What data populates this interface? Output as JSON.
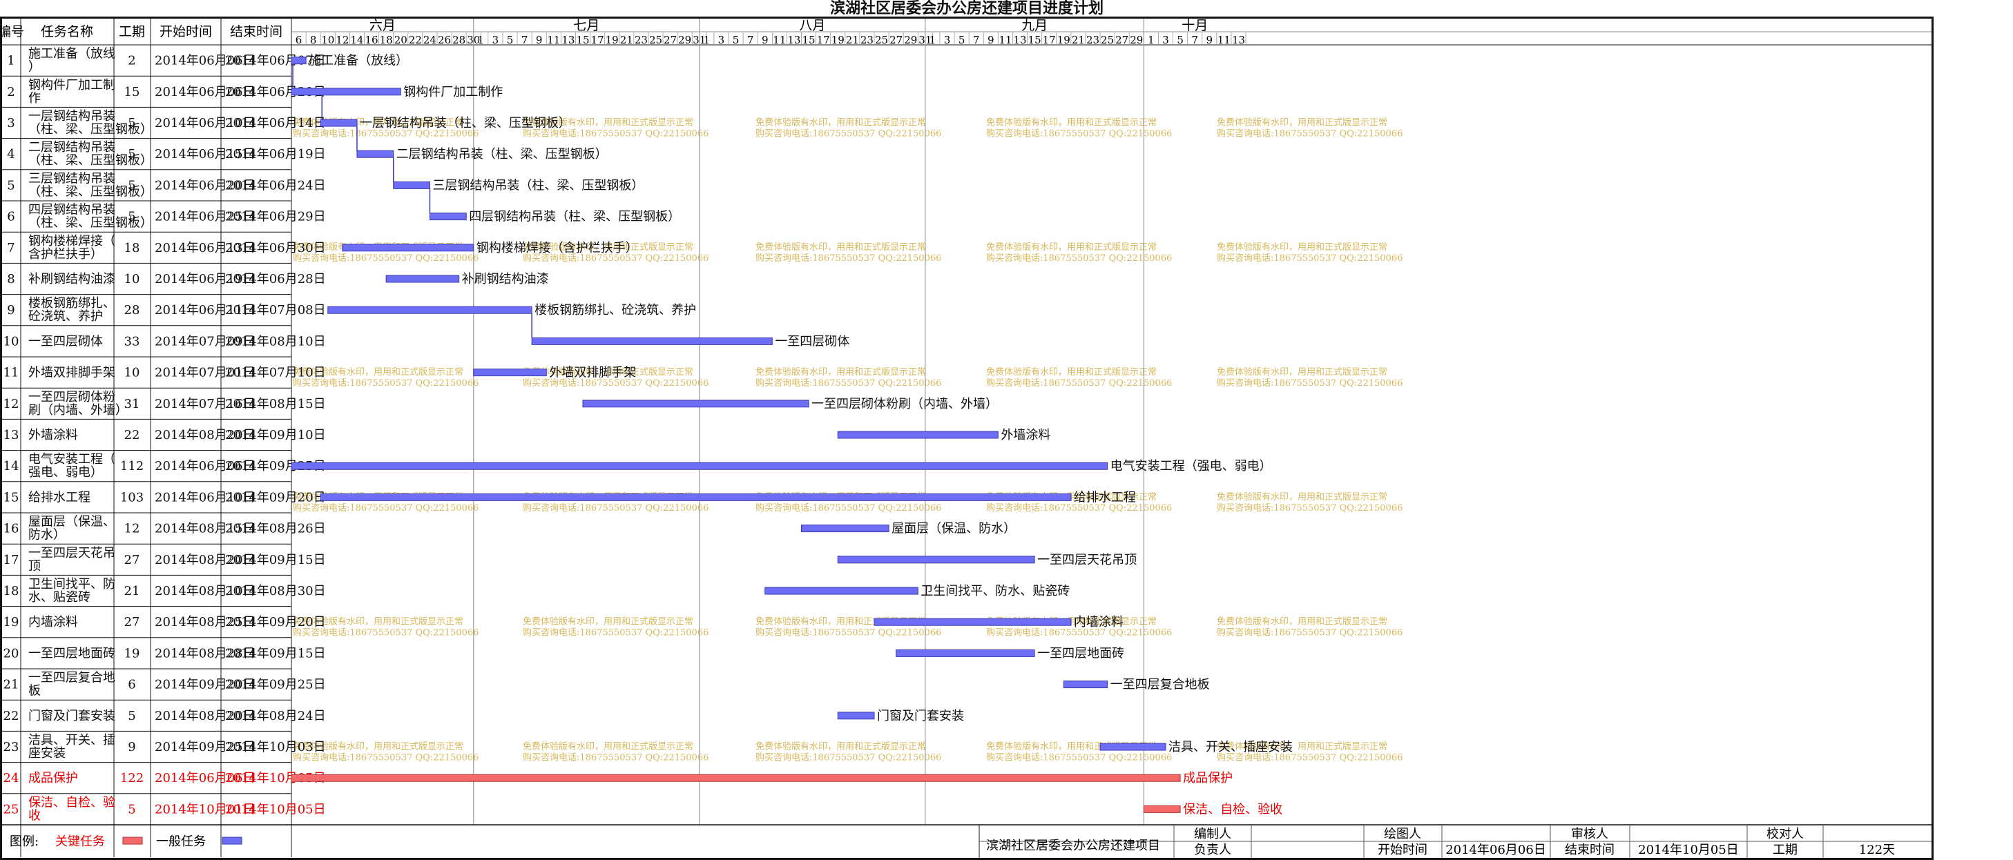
{
  "title": "滨湖社区居委会办公房还建项目进度计划",
  "columns": [
    "编号",
    "任务名称",
    "工期",
    "开始时间",
    "结束时间"
  ],
  "colors": {
    "normal_bar": "#6d6df5",
    "critical_bar": "#f46a6a",
    "critical_text": "#e60000",
    "grid": "#aaaaaa",
    "watermark": "#d8b85a"
  },
  "chart_data": {
    "type": "gantt",
    "title": "滨湖社区居委会办公房还建项目进度计划",
    "timeline": {
      "start": "2014-06-06",
      "end": "2014-10-14",
      "months": [
        {
          "label": "六月",
          "start": "2014-06-06",
          "end": "2014-06-30"
        },
        {
          "label": "七月",
          "start": "2014-07-01",
          "end": "2014-07-31"
        },
        {
          "label": "八月",
          "start": "2014-08-01",
          "end": "2014-08-31"
        },
        {
          "label": "九月",
          "start": "2014-09-01",
          "end": "2014-09-30"
        },
        {
          "label": "十月",
          "start": "2014-10-01",
          "end": "2014-10-14"
        }
      ]
    },
    "tasks": [
      {
        "id": "1",
        "name": "施工准备（放线）",
        "bar_label": "施工准备（放线）",
        "duration": "2",
        "start": "2014年06月06日",
        "end": "2014年06月07日",
        "critical": false,
        "s": "2014-06-06",
        "e": "2014-06-07"
      },
      {
        "id": "2",
        "name": "钢构件厂加工制作",
        "bar_label": "钢构件厂加工制作",
        "duration": "15",
        "start": "2014年06月06日",
        "end": "2014年06月20日",
        "critical": false,
        "s": "2014-06-06",
        "e": "2014-06-20"
      },
      {
        "id": "3",
        "name": "一层钢结构吊装（柱、梁、压型钢板）",
        "bar_label": "一层钢结构吊装（柱、梁、压型钢板）",
        "duration": "5",
        "start": "2014年06月10日",
        "end": "2014年06月14日",
        "critical": false,
        "s": "2014-06-10",
        "e": "2014-06-14"
      },
      {
        "id": "4",
        "name": "二层钢结构吊装（柱、梁、压型钢板）",
        "bar_label": "二层钢结构吊装（柱、梁、压型钢板）",
        "duration": "5",
        "start": "2014年06月15日",
        "end": "2014年06月19日",
        "critical": false,
        "s": "2014-06-15",
        "e": "2014-06-19"
      },
      {
        "id": "5",
        "name": "三层钢结构吊装（柱、梁、压型钢板）",
        "bar_label": "三层钢结构吊装（柱、梁、压型钢板）",
        "duration": "5",
        "start": "2014年06月20日",
        "end": "2014年06月24日",
        "critical": false,
        "s": "2014-06-20",
        "e": "2014-06-24"
      },
      {
        "id": "6",
        "name": "四层钢结构吊装（柱、梁、压型钢板）",
        "bar_label": "四层钢结构吊装（柱、梁、压型钢板）",
        "duration": "5",
        "start": "2014年06月25日",
        "end": "2014年06月29日",
        "critical": false,
        "s": "2014-06-25",
        "e": "2014-06-29"
      },
      {
        "id": "7",
        "name": "钢构楼梯焊接（含护栏扶手）",
        "bar_label": "钢构楼梯焊接（含护栏扶手）",
        "duration": "18",
        "start": "2014年06月13日",
        "end": "2014年06月30日",
        "critical": false,
        "s": "2014-06-13",
        "e": "2014-06-30"
      },
      {
        "id": "8",
        "name": "补刷钢结构油漆",
        "bar_label": "补刷钢结构油漆",
        "duration": "10",
        "start": "2014年06月19日",
        "end": "2014年06月28日",
        "critical": false,
        "s": "2014-06-19",
        "e": "2014-06-28"
      },
      {
        "id": "9",
        "name": "楼板钢筋绑扎、砼浇筑、养护",
        "bar_label": "楼板钢筋绑扎、砼浇筑、养护",
        "duration": "28",
        "start": "2014年06月11日",
        "end": "2014年07月08日",
        "critical": false,
        "s": "2014-06-11",
        "e": "2014-07-08"
      },
      {
        "id": "10",
        "name": "一至四层砌体",
        "bar_label": "一至四层砌体",
        "duration": "33",
        "start": "2014年07月09日",
        "end": "2014年08月10日",
        "critical": false,
        "s": "2014-07-09",
        "e": "2014-08-10"
      },
      {
        "id": "11",
        "name": "外墙双排脚手架",
        "bar_label": "外墙双排脚手架",
        "duration": "10",
        "start": "2014年07月01日",
        "end": "2014年07月10日",
        "critical": false,
        "s": "2014-07-01",
        "e": "2014-07-10"
      },
      {
        "id": "12",
        "name": "一至四层砌体粉刷（内墙、外墙）",
        "bar_label": "一至四层砌体粉刷（内墙、外墙）",
        "duration": "31",
        "start": "2014年07月16日",
        "end": "2014年08月15日",
        "critical": false,
        "s": "2014-07-16",
        "e": "2014-08-15"
      },
      {
        "id": "13",
        "name": "外墙涂料",
        "bar_label": "外墙涂料",
        "duration": "22",
        "start": "2014年08月20日",
        "end": "2014年09月10日",
        "critical": false,
        "s": "2014-08-20",
        "e": "2014-09-10"
      },
      {
        "id": "14",
        "name": "电气安装工程（强电、弱电）",
        "bar_label": "电气安装工程（强电、弱电）",
        "duration": "112",
        "start": "2014年06月06日",
        "end": "2014年09月25日",
        "critical": false,
        "s": "2014-06-06",
        "e": "2014-09-25"
      },
      {
        "id": "15",
        "name": "给排水工程",
        "bar_label": "给排水工程",
        "duration": "103",
        "start": "2014年06月10日",
        "end": "2014年09月20日",
        "critical": false,
        "s": "2014-06-10",
        "e": "2014-09-20"
      },
      {
        "id": "16",
        "name": "屋面层（保温、防水）",
        "bar_label": "屋面层（保温、防水）",
        "duration": "12",
        "start": "2014年08月15日",
        "end": "2014年08月26日",
        "critical": false,
        "s": "2014-08-15",
        "e": "2014-08-26"
      },
      {
        "id": "17",
        "name": "一至四层天花吊顶",
        "bar_label": "一至四层天花吊顶",
        "duration": "27",
        "start": "2014年08月20日",
        "end": "2014年09月15日",
        "critical": false,
        "s": "2014-08-20",
        "e": "2014-09-15"
      },
      {
        "id": "18",
        "name": "卫生间找平、防水、贴瓷砖",
        "bar_label": "卫生间找平、防水、贴瓷砖",
        "duration": "21",
        "start": "2014年08月10日",
        "end": "2014年08月30日",
        "critical": false,
        "s": "2014-08-10",
        "e": "2014-08-30"
      },
      {
        "id": "19",
        "name": "内墙涂料",
        "bar_label": "内墙涂料",
        "duration": "27",
        "start": "2014年08月25日",
        "end": "2014年09月20日",
        "critical": false,
        "s": "2014-08-25",
        "e": "2014-09-20"
      },
      {
        "id": "20",
        "name": "一至四层地面砖",
        "bar_label": "一至四层地面砖",
        "duration": "19",
        "start": "2014年08月28日",
        "end": "2014年09月15日",
        "critical": false,
        "s": "2014-08-28",
        "e": "2014-09-15"
      },
      {
        "id": "21",
        "name": "一至四层复合地板",
        "bar_label": "一至四层复合地板",
        "duration": "6",
        "start": "2014年09月20日",
        "end": "2014年09月25日",
        "critical": false,
        "s": "2014-09-20",
        "e": "2014-09-25"
      },
      {
        "id": "22",
        "name": "门窗及门套安装",
        "bar_label": "门窗及门套安装",
        "duration": "5",
        "start": "2014年08月20日",
        "end": "2014年08月24日",
        "critical": false,
        "s": "2014-08-20",
        "e": "2014-08-24"
      },
      {
        "id": "23",
        "name": "洁具、开关、插座安装",
        "bar_label": "洁具、开关、插座安装",
        "duration": "9",
        "start": "2014年09月25日",
        "end": "2014年10月03日",
        "critical": false,
        "s": "2014-09-25",
        "e": "2014-10-03"
      },
      {
        "id": "24",
        "name": "成品保护",
        "bar_label": "成品保护",
        "duration": "122",
        "start": "2014年06月06日",
        "end": "2014年10月05日",
        "critical": true,
        "s": "2014-06-06",
        "e": "2014-10-05"
      },
      {
        "id": "25",
        "name": "保洁、自检、验收",
        "bar_label": "保洁、自检、验收",
        "duration": "5",
        "start": "2014年10月01日",
        "end": "2014年10月05日",
        "critical": true,
        "s": "2014-10-01",
        "e": "2014-10-05"
      }
    ],
    "links": [
      [
        "1",
        "2"
      ],
      [
        "2",
        "3"
      ],
      [
        "3",
        "4"
      ],
      [
        "4",
        "5"
      ],
      [
        "5",
        "6"
      ],
      [
        "9",
        "10"
      ]
    ],
    "legend": {
      "label": "图例:",
      "items": [
        {
          "label": "关键任务",
          "critical": true
        },
        {
          "label": "一般任务",
          "critical": false
        }
      ]
    }
  },
  "watermark": {
    "line1": "免费体验版有水印，用用和正式版显示正常",
    "line2": "购买咨询电话:18675550537 QQ:22150066"
  },
  "footer": {
    "project": "滨湖社区居委会办公房还建项目",
    "labels": {
      "compiler": "编制人",
      "drawer": "绘图人",
      "reviewer": "审核人",
      "checker": "校对人",
      "leader": "负责人",
      "start": "开始时间",
      "end": "结束时间",
      "duration": "工期"
    },
    "values": {
      "start": "2014年06月06日",
      "end": "2014年10月05日",
      "duration": "122天"
    }
  }
}
